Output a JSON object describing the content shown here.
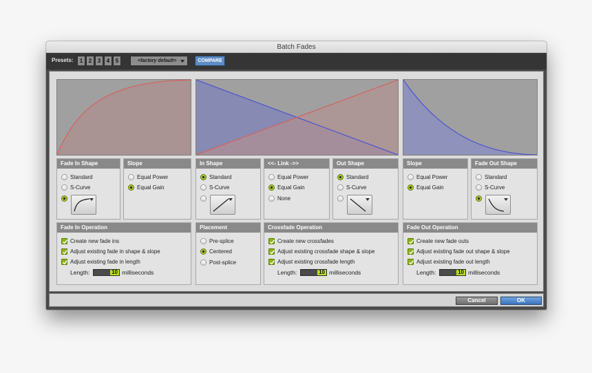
{
  "window": {
    "title": "Batch Fades"
  },
  "toolbar": {
    "presets_label": "Presets:",
    "preset_buttons": [
      "1",
      "2",
      "3",
      "4",
      "5"
    ],
    "preset_select_value": "<factory default>",
    "compare_label": "COMPARE"
  },
  "fade_in": {
    "shape": {
      "title": "Fade In Shape",
      "standard": "Standard",
      "s_curve": "S-Curve",
      "selected": "custom"
    },
    "slope": {
      "title": "Slope",
      "equal_power": "Equal Power",
      "equal_gain": "Equal Gain",
      "selected": "Equal Gain"
    },
    "operation": {
      "title": "Fade In Operation",
      "options": [
        "Create new fade ins",
        "Adjust existing fade in shape & slope",
        "Adjust existing fade in length"
      ],
      "length_label": "Length:",
      "length_value": "10",
      "length_unit": "milliseconds"
    }
  },
  "crossfade": {
    "in_shape": {
      "title": "In Shape",
      "standard": "Standard",
      "s_curve": "S-Curve",
      "selected": "Standard"
    },
    "link": {
      "title": "<<- Link ->>",
      "equal_power": "Equal Power",
      "equal_gain": "Equal Gain",
      "none": "None",
      "selected": "Equal Gain"
    },
    "out_shape": {
      "title": "Out Shape",
      "standard": "Standard",
      "s_curve": "S-Curve",
      "selected": "Standard"
    },
    "placement": {
      "title": "Placement",
      "pre_splice": "Pre-splice",
      "centered": "Centered",
      "post_splice": "Post-splice",
      "selected": "Centered"
    },
    "operation": {
      "title": "Crossfade Operation",
      "options": [
        "Create new crossfades",
        "Adjust existing crossfade shape & slope",
        "Adjust existing crossfade length"
      ],
      "length_label": "Length:",
      "length_value": "10",
      "length_unit": "milliseconds"
    }
  },
  "fade_out": {
    "slope": {
      "title": "Slope",
      "equal_power": "Equal Power",
      "equal_gain": "Equal Gain",
      "selected": "Equal Gain"
    },
    "shape": {
      "title": "Fade Out Shape",
      "standard": "Standard",
      "s_curve": "S-Curve",
      "selected": "custom"
    },
    "operation": {
      "title": "Fade Out Operation",
      "options": [
        "Create new fade outs",
        "Adjust existing fade out shape & slope",
        "Adjust existing fade out length"
      ],
      "length_label": "Length:",
      "length_value": "10",
      "length_unit": "milliseconds"
    }
  },
  "footer": {
    "cancel_label": "Cancel",
    "ok_label": "OK"
  },
  "colors": {
    "fade_in_curve": "#d9605a",
    "fade_out_curve": "#4b52d2",
    "radio_selected": "#8db316",
    "ok_button": "#4a82c8"
  }
}
